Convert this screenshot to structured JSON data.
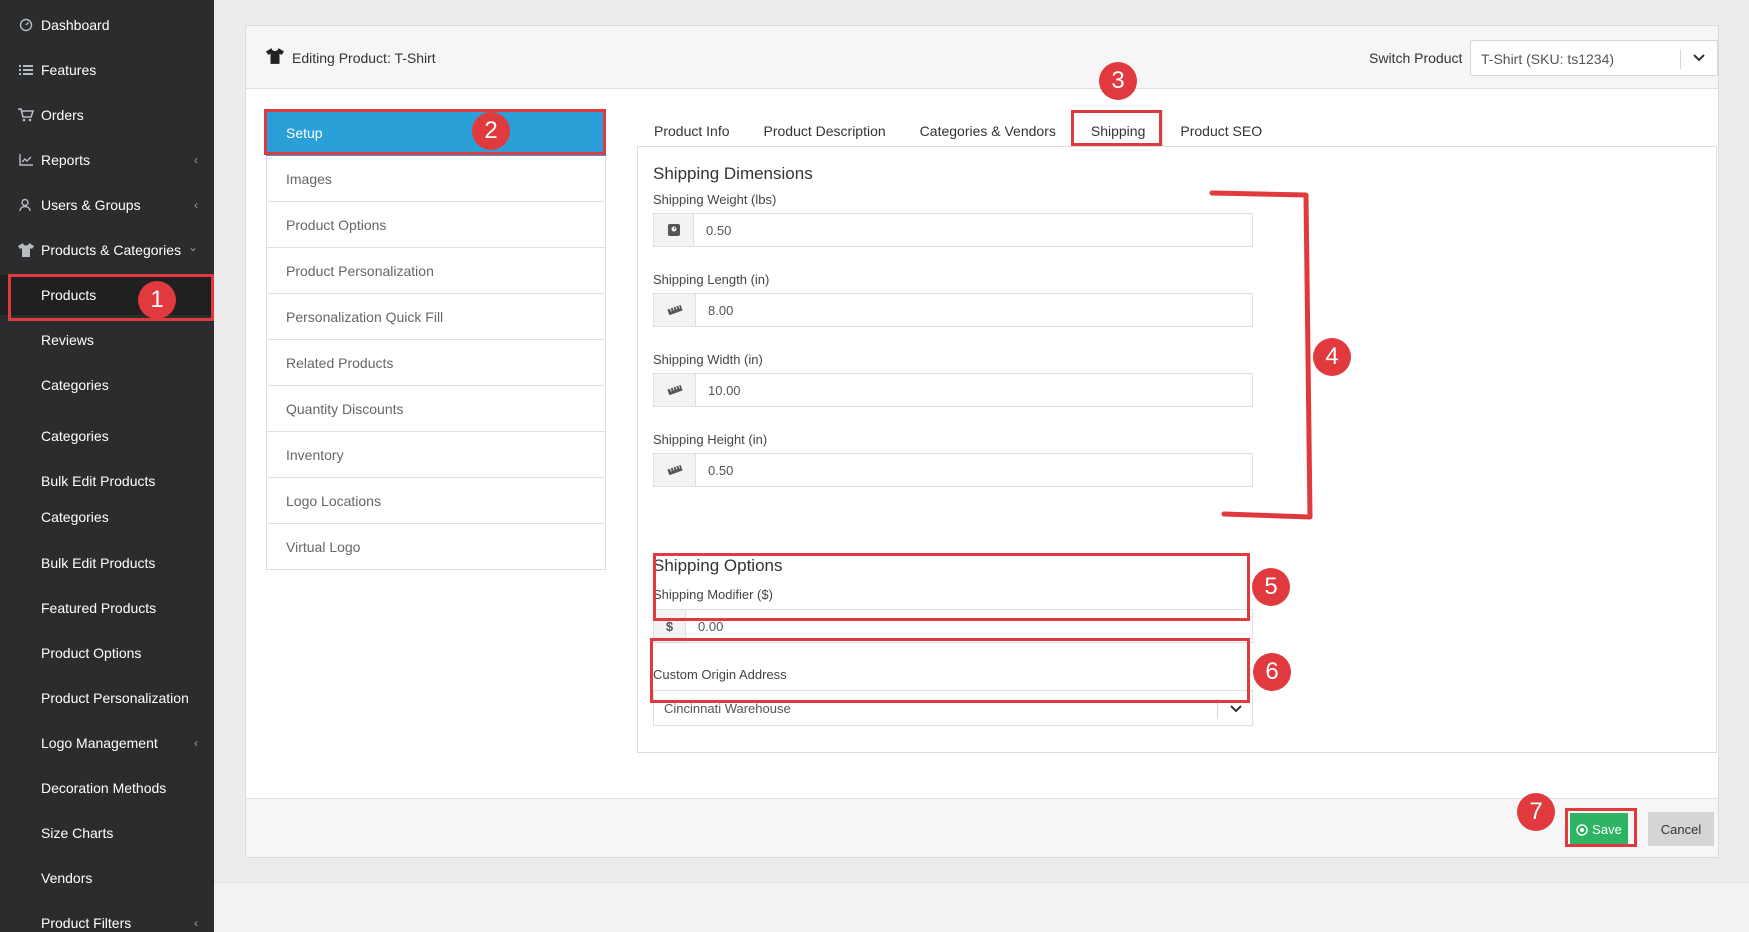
{
  "sidebar": {
    "items": [
      {
        "label": "Dashboard",
        "icon": "dashboard-icon",
        "chevron": ""
      },
      {
        "label": "Features",
        "icon": "list-icon",
        "chevron": ""
      },
      {
        "label": "Orders",
        "icon": "cart-icon",
        "chevron": ""
      },
      {
        "label": "Reports",
        "icon": "chart-icon",
        "chevron": "‹"
      },
      {
        "label": "Users & Groups",
        "icon": "users-icon",
        "chevron": "‹"
      },
      {
        "label": "Products & Categories",
        "icon": "shirt-icon",
        "chevron": "⌄"
      },
      {
        "label": "Products",
        "icon": "",
        "chevron": ""
      },
      {
        "label": "Reviews",
        "icon": "",
        "chevron": ""
      },
      {
        "label": "Categories",
        "icon": "",
        "chevron": ""
      },
      {
        "label": "Categories",
        "icon": "",
        "chevron": ""
      },
      {
        "label": "Bulk Edit Products",
        "icon": "",
        "chevron": ""
      },
      {
        "label": "Categories",
        "icon": "",
        "chevron": ""
      },
      {
        "label": "Bulk Edit Products",
        "icon": "",
        "chevron": ""
      },
      {
        "label": "Featured Products",
        "icon": "",
        "chevron": ""
      },
      {
        "label": "Product Options",
        "icon": "",
        "chevron": ""
      },
      {
        "label": "Product Personalization",
        "icon": "",
        "chevron": ""
      },
      {
        "label": "Logo Management",
        "icon": "",
        "chevron": "‹"
      },
      {
        "label": "Decoration Methods",
        "icon": "",
        "chevron": ""
      },
      {
        "label": "Size Charts",
        "icon": "",
        "chevron": ""
      },
      {
        "label": "Vendors",
        "icon": "",
        "chevron": ""
      },
      {
        "label": "Product Filters",
        "icon": "",
        "chevron": "‹"
      }
    ]
  },
  "header": {
    "title": "Editing Product: T-Shirt",
    "switch_label": "Switch Product",
    "switch_value": "T-Shirt (SKU: ts1234)"
  },
  "setup_menu": {
    "items": [
      "Setup",
      "Images",
      "Product Options",
      "Product Personalization",
      "Personalization Quick Fill",
      "Related Products",
      "Quantity Discounts",
      "Inventory",
      "Logo Locations",
      "Virtual Logo"
    ]
  },
  "tabs": [
    "Product Info",
    "Product Description",
    "Categories & Vendors",
    "Shipping",
    "Product SEO"
  ],
  "shipping": {
    "dimensions_title": "Shipping Dimensions",
    "weight_label": "Shipping Weight (lbs)",
    "weight_value": "0.50",
    "length_label": "Shipping Length (in)",
    "length_value": "8.00",
    "width_label": "Shipping Width (in)",
    "width_value": "10.00",
    "height_label": "Shipping Height (in)",
    "height_value": "0.50",
    "options_title": "Shipping Options",
    "modifier_label": "Shipping Modifier ($)",
    "modifier_addon": "$",
    "modifier_value": "0.00",
    "origin_label": "Custom Origin Address",
    "origin_value": "Cincinnati Warehouse"
  },
  "footer": {
    "save_label": "Save",
    "cancel_label": "Cancel"
  },
  "annotations": [
    "1",
    "2",
    "3",
    "4",
    "5",
    "6",
    "7"
  ],
  "colors": {
    "sidebar_bg": "#2b2c2e",
    "active_blue": "#2a9fd8",
    "save_green": "#2fb463",
    "annotation_red": "#e0393e"
  }
}
